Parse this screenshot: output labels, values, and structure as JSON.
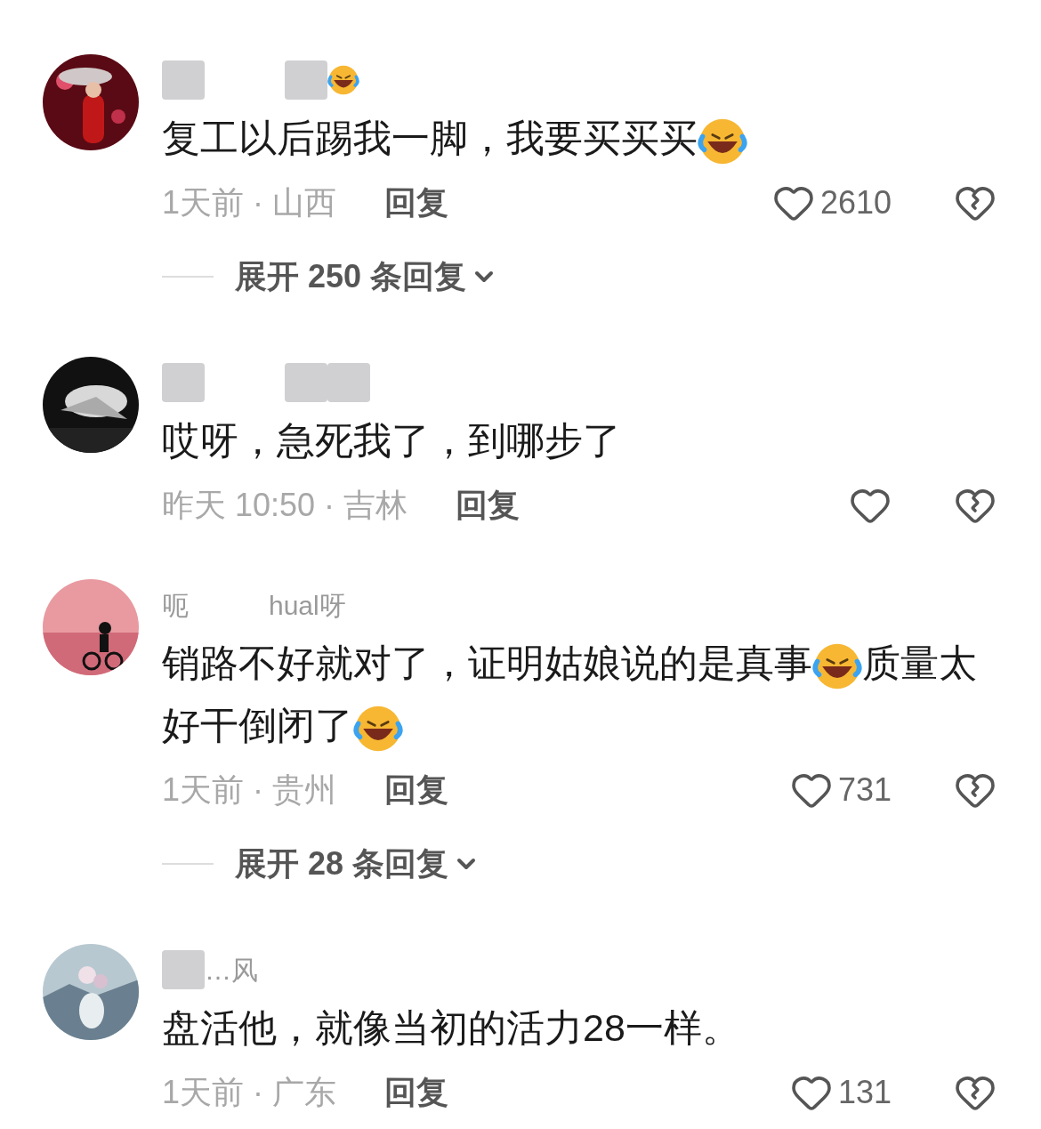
{
  "comments": [
    {
      "avatar": {
        "kind": "picture"
      },
      "username": [
        {
          "kind": "blur"
        },
        {
          "kind": "gap"
        },
        {
          "kind": "blur"
        },
        {
          "kind": "emoji"
        }
      ],
      "body": [
        {
          "kind": "text",
          "text": "复工以后踢我一脚，我要买买买"
        },
        {
          "kind": "emoji"
        }
      ],
      "meta": "1天前 · 山西",
      "reply": "回复",
      "likes": "2610",
      "expand": "展开 250 条回复"
    },
    {
      "avatar": {
        "kind": "picture"
      },
      "username": [
        {
          "kind": "blur"
        },
        {
          "kind": "gap"
        },
        {
          "kind": "blur"
        },
        {
          "kind": "blur"
        }
      ],
      "body": [
        {
          "kind": "text",
          "text": "哎呀，急死我了，到哪步了"
        }
      ],
      "meta": "昨天 10:50 · 吉林",
      "reply": "回复"
    },
    {
      "avatar": {
        "kind": "picture"
      },
      "username": [
        {
          "kind": "text",
          "text": "呃"
        },
        {
          "kind": "gap"
        },
        {
          "kind": "text",
          "text": "hual呀"
        }
      ],
      "body": [
        {
          "kind": "text",
          "text": "销路不好就对了，证明姑娘说的是真事"
        },
        {
          "kind": "emoji"
        },
        {
          "kind": "text",
          "text": "质量太好干倒闭了"
        },
        {
          "kind": "emoji"
        }
      ],
      "meta": "1天前 · 贵州",
      "reply": "回复",
      "likes": "731",
      "expand": "展开 28 条回复"
    },
    {
      "avatar": {
        "kind": "picture"
      },
      "username": [
        {
          "kind": "blur"
        },
        {
          "kind": "text",
          "text": "…风"
        }
      ],
      "body": [
        {
          "kind": "text",
          "text": "盘活他，就像当初的活力28一样。"
        }
      ],
      "meta": "1天前 · 广东",
      "reply": "回复",
      "likes": "131"
    }
  ]
}
